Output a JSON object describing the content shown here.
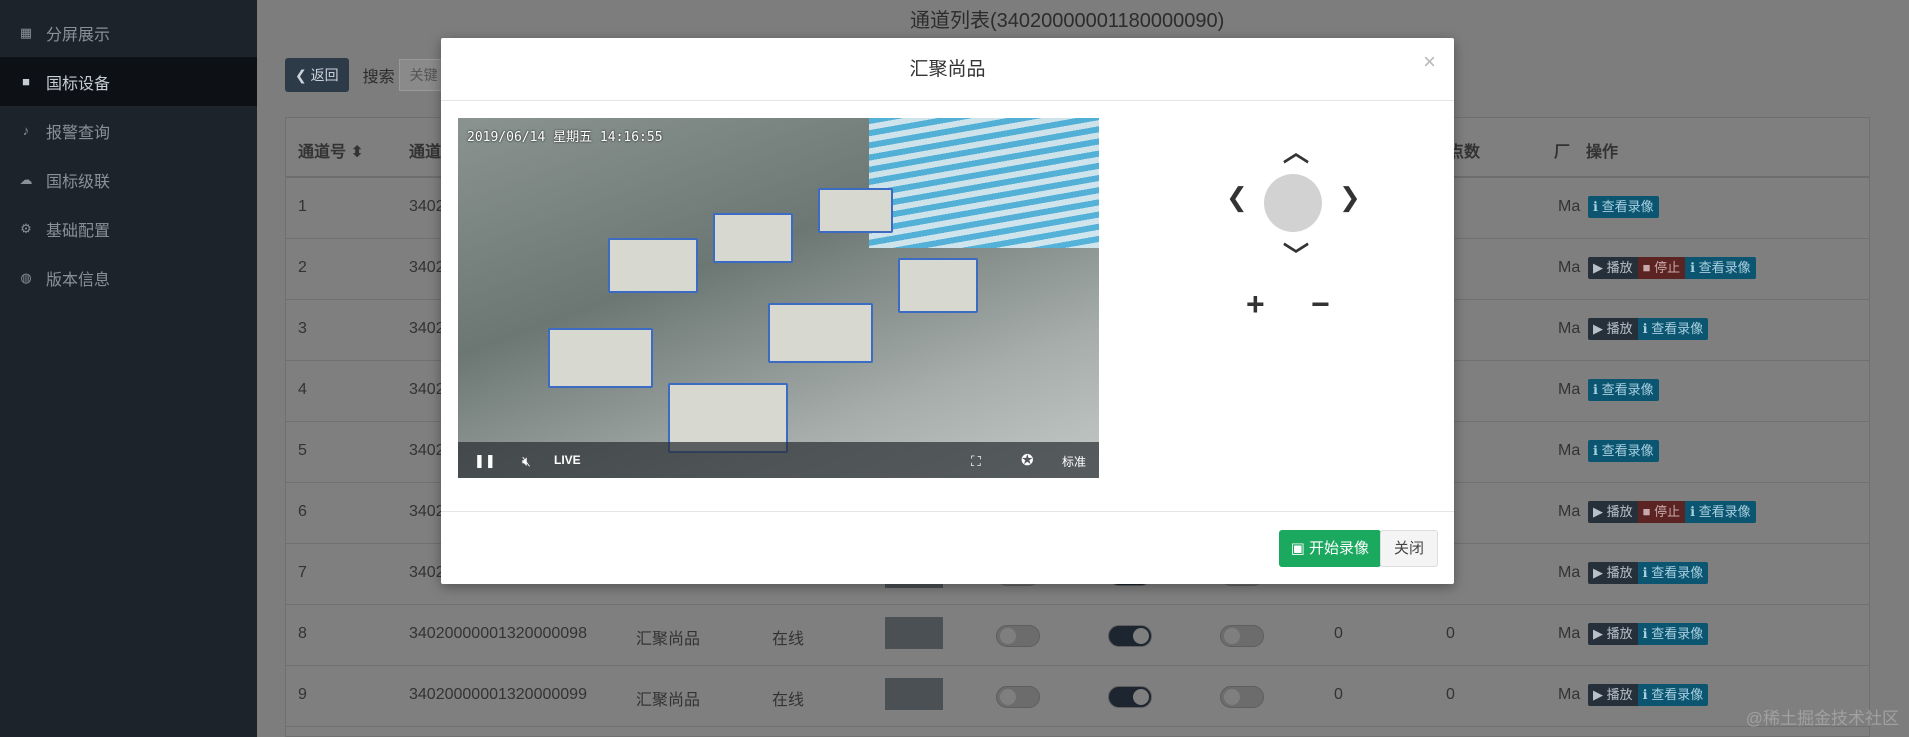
{
  "sidebar": {
    "items": [
      {
        "label": "分屏展示",
        "icon": "grid-icon"
      },
      {
        "label": "国标设备",
        "icon": "camera-icon"
      },
      {
        "label": "报警查询",
        "icon": "bell-icon"
      },
      {
        "label": "国标级联",
        "icon": "cloud-upload-icon"
      },
      {
        "label": "基础配置",
        "icon": "gears-icon"
      },
      {
        "label": "版本信息",
        "icon": "globe-icon"
      }
    ]
  },
  "main": {
    "title": "通道列表(34020000001180000090)",
    "back_label": "返回",
    "search_label": "搜索",
    "search_placeholder": "关键",
    "headers": {
      "channel_no": "通道号",
      "channel": "通道",
      "subnodes": "子节点数",
      "vendor": "厂",
      "actions": "操作"
    },
    "rows": [
      {
        "no": "1",
        "id": "3402",
        "name": "",
        "status": "",
        "ops": [
          "rec"
        ]
      },
      {
        "no": "2",
        "id": "3402",
        "name": "",
        "status": "",
        "ops": [
          "play",
          "stop",
          "rec"
        ]
      },
      {
        "no": "3",
        "id": "3402",
        "name": "",
        "status": "",
        "ops": [
          "play",
          "rec"
        ]
      },
      {
        "no": "4",
        "id": "3402",
        "name": "",
        "status": "",
        "ops": [
          "rec"
        ]
      },
      {
        "no": "5",
        "id": "3402",
        "name": "",
        "status": "",
        "ops": [
          "rec"
        ]
      },
      {
        "no": "6",
        "id": "3402",
        "name": "",
        "status": "",
        "ops": [
          "play",
          "stop",
          "rec"
        ]
      },
      {
        "no": "7",
        "id": "3402",
        "name": "",
        "status": "",
        "ops": [
          "play",
          "rec"
        ]
      },
      {
        "no": "8",
        "id": "34020000001320000098",
        "name": "汇聚尚品",
        "status": "在线",
        "n1": "0",
        "n2": "0",
        "vendor": "Ma",
        "ops": [
          "play",
          "rec"
        ]
      },
      {
        "no": "9",
        "id": "34020000001320000099",
        "name": "汇聚尚品",
        "status": "在线",
        "n1": "0",
        "n2": "0",
        "vendor": "Ma",
        "ops": [
          "play",
          "rec"
        ]
      }
    ],
    "op_labels": {
      "play": "播放",
      "stop": "停止",
      "rec": "查看录像"
    },
    "vendor_short": "Ma"
  },
  "modal": {
    "title": "汇聚尚品",
    "close_x": "×",
    "video": {
      "timestamp": "2019/06/14 星期五 14:16:55",
      "live_label": "LIVE",
      "quality_label": "标准"
    },
    "ptz": {
      "zoom_in": "+",
      "zoom_out": "−"
    },
    "record_button": "开始录像",
    "close_button": "关闭"
  },
  "watermark": "@稀土掘金技术社区"
}
